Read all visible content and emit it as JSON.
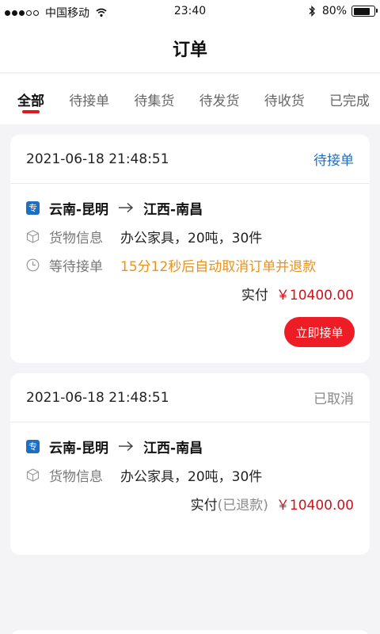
{
  "status_bar": {
    "carrier": "中国移动",
    "time": "23:40",
    "battery": "80%",
    "battery_level": 0.8,
    "signal_icon": "signal-dots-icon",
    "wifi_icon": "wifi-icon",
    "bluetooth_icon": "bluetooth-icon"
  },
  "header": {
    "title": "订单"
  },
  "tabs": [
    {
      "label": "全部",
      "active": true
    },
    {
      "label": "待接单",
      "active": false
    },
    {
      "label": "待集货",
      "active": false
    },
    {
      "label": "待发货",
      "active": false
    },
    {
      "label": "待收货",
      "active": false
    },
    {
      "label": "已完成",
      "active": false
    }
  ],
  "orders": [
    {
      "datetime": "2021-06-18  21:48:51",
      "status": "待接单",
      "type_badge": "专",
      "origin": "云南-昆明",
      "destination": "江西-南昌",
      "goods_label": "货物信息",
      "goods_value": "办公家具，20吨，30件",
      "wait_label": "等待接单",
      "wait_value": "15分12秒后自动取消订单并退款",
      "pay_label": "实付",
      "amount": "￥10400.00",
      "button_label": "立即接单"
    },
    {
      "datetime": "2021-06-18  21:48:51",
      "status": "已取消",
      "type_badge": "专",
      "origin": "云南-昆明",
      "destination": "江西-南昌",
      "goods_label": "货物信息",
      "goods_value": "办公家具，20吨，30件",
      "pay_label": "实付",
      "refund_note": "(已退款)",
      "amount": "￥10400.00"
    }
  ],
  "colors": {
    "accent_red": "#ee1c25",
    "status_blue": "#1e6fc4",
    "warning_orange": "#e79321",
    "price_red": "#d0121b"
  }
}
